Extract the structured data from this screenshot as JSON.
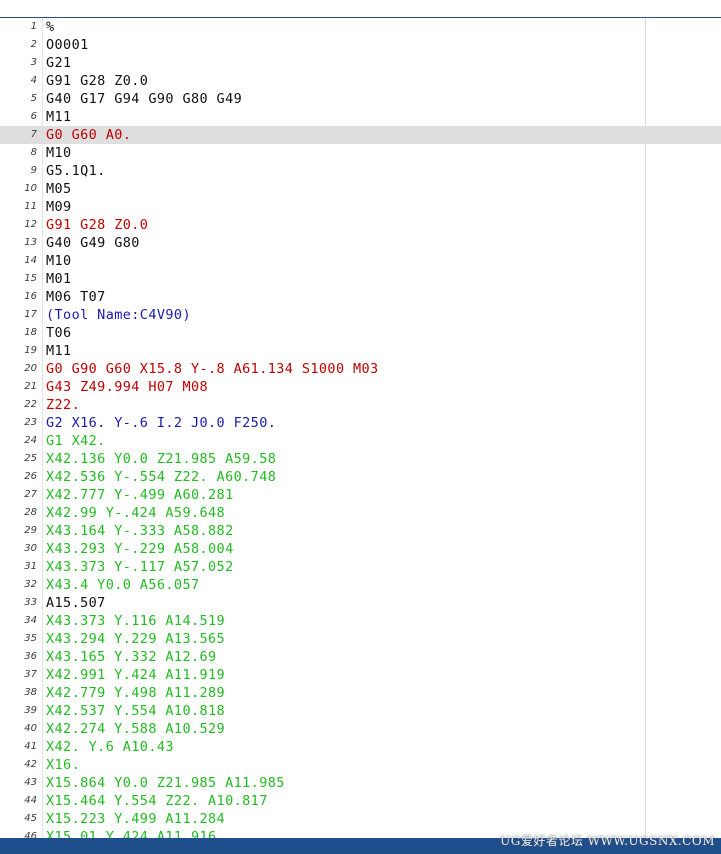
{
  "editor": {
    "lines": [
      {
        "num": "1",
        "text": "%",
        "color": "black"
      },
      {
        "num": "2",
        "text": "O0001",
        "color": "black"
      },
      {
        "num": "3",
        "text": "G21",
        "color": "black"
      },
      {
        "num": "4",
        "text": "G91 G28 Z0.0",
        "color": "black"
      },
      {
        "num": "5",
        "text": "G40 G17 G94 G90 G80 G49",
        "color": "black"
      },
      {
        "num": "6",
        "text": "M11",
        "color": "black"
      },
      {
        "num": "7",
        "text": "G0 G60 A0.",
        "color": "red",
        "current": true
      },
      {
        "num": "8",
        "text": "M10",
        "color": "black"
      },
      {
        "num": "9",
        "text": "G5.1Q1.",
        "color": "black"
      },
      {
        "num": "10",
        "text": "M05",
        "color": "black"
      },
      {
        "num": "11",
        "text": "M09",
        "color": "black"
      },
      {
        "num": "12",
        "text": "G91 G28 Z0.0",
        "color": "red"
      },
      {
        "num": "13",
        "text": "G40 G49 G80",
        "color": "black"
      },
      {
        "num": "14",
        "text": "M10",
        "color": "black"
      },
      {
        "num": "15",
        "text": "M01",
        "color": "black"
      },
      {
        "num": "16",
        "text": "M06 T07",
        "color": "black"
      },
      {
        "num": "17",
        "text": "(Tool Name:C4V90)",
        "color": "blue"
      },
      {
        "num": "18",
        "text": "T06",
        "color": "black"
      },
      {
        "num": "19",
        "text": "M11",
        "color": "black"
      },
      {
        "num": "20",
        "text": "G0 G90 G60 X15.8 Y-.8 A61.134 S1000 M03",
        "color": "red"
      },
      {
        "num": "21",
        "text": "G43 Z49.994 H07 M08",
        "color": "red"
      },
      {
        "num": "22",
        "text": "Z22.",
        "color": "red"
      },
      {
        "num": "23",
        "text": "G2 X16. Y-.6 I.2 J0.0 F250.",
        "color": "blue"
      },
      {
        "num": "24",
        "text": "G1 X42.",
        "color": "green"
      },
      {
        "num": "25",
        "text": "X42.136 Y0.0 Z21.985 A59.58",
        "color": "green"
      },
      {
        "num": "26",
        "text": "X42.536 Y-.554 Z22. A60.748",
        "color": "green"
      },
      {
        "num": "27",
        "text": "X42.777 Y-.499 A60.281",
        "color": "green"
      },
      {
        "num": "28",
        "text": "X42.99 Y-.424 A59.648",
        "color": "green"
      },
      {
        "num": "29",
        "text": "X43.164 Y-.333 A58.882",
        "color": "green"
      },
      {
        "num": "30",
        "text": "X43.293 Y-.229 A58.004",
        "color": "green"
      },
      {
        "num": "31",
        "text": "X43.373 Y-.117 A57.052",
        "color": "green"
      },
      {
        "num": "32",
        "text": "X43.4 Y0.0 A56.057",
        "color": "green"
      },
      {
        "num": "33",
        "text": "A15.507",
        "color": "black"
      },
      {
        "num": "34",
        "text": "X43.373 Y.116 A14.519",
        "color": "green"
      },
      {
        "num": "35",
        "text": "X43.294 Y.229 A13.565",
        "color": "green"
      },
      {
        "num": "36",
        "text": "X43.165 Y.332 A12.69",
        "color": "green"
      },
      {
        "num": "37",
        "text": "X42.991 Y.424 A11.919",
        "color": "green"
      },
      {
        "num": "38",
        "text": "X42.779 Y.498 A11.289",
        "color": "green"
      },
      {
        "num": "39",
        "text": "X42.537 Y.554 A10.818",
        "color": "green"
      },
      {
        "num": "40",
        "text": "X42.274 Y.588 A10.529",
        "color": "green"
      },
      {
        "num": "41",
        "text": "X42. Y.6 A10.43",
        "color": "green"
      },
      {
        "num": "42",
        "text": "X16.",
        "color": "green"
      },
      {
        "num": "43",
        "text": "X15.864 Y0.0 Z21.985 A11.985",
        "color": "green"
      },
      {
        "num": "44",
        "text": "X15.464 Y.554 Z22. A10.817",
        "color": "green"
      },
      {
        "num": "45",
        "text": "X15.223 Y.499 A11.284",
        "color": "green"
      },
      {
        "num": "46",
        "text": "X15.01 Y.424 A11.916",
        "color": "green"
      }
    ]
  },
  "watermark": "UG爱好者论坛 WWW.UGSNX.COM",
  "colors": {
    "black": "#111111",
    "red": "#c00000",
    "blue": "#1a1ab0",
    "green": "#22bb22",
    "statusbar": "#1f4e8c",
    "current_line": "#dedede"
  }
}
